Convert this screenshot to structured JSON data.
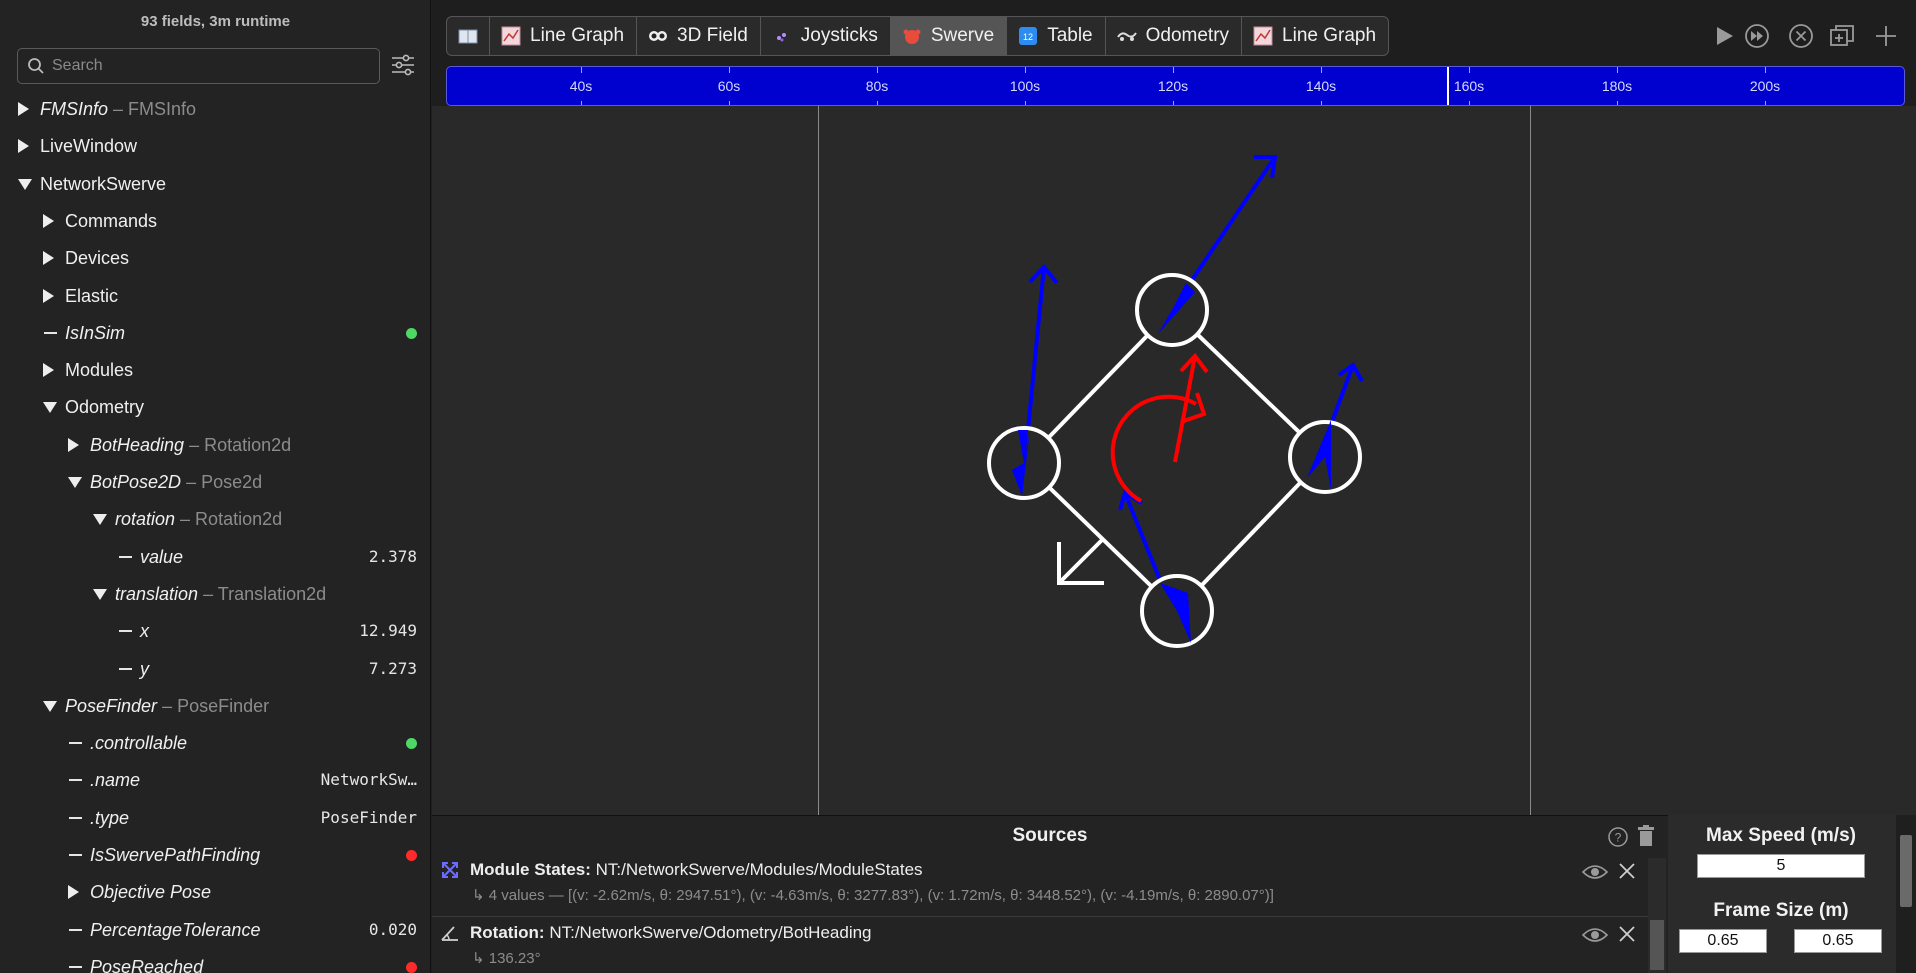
{
  "sidebar": {
    "runtime": "93 fields, 3m runtime",
    "search_placeholder": "Search",
    "tree": [
      {
        "label": "FMSInfo",
        "type": " – FMSInfo",
        "italic": true,
        "kind": "closed",
        "indent": 0
      },
      {
        "label": "LiveWindow",
        "type": "",
        "italic": false,
        "kind": "closed",
        "indent": 0
      },
      {
        "label": "NetworkSwerve",
        "type": "",
        "italic": false,
        "kind": "open",
        "indent": 0
      },
      {
        "label": "Commands",
        "type": "",
        "italic": false,
        "kind": "closed",
        "indent": 1
      },
      {
        "label": "Devices",
        "type": "",
        "italic": false,
        "kind": "closed",
        "indent": 1
      },
      {
        "label": "Elastic",
        "type": "",
        "italic": false,
        "kind": "closed",
        "indent": 1
      },
      {
        "label": "IsInSim",
        "type": "",
        "italic": true,
        "kind": "leaf",
        "indent": 1,
        "dot": "#4cd964"
      },
      {
        "label": "Modules",
        "type": "",
        "italic": false,
        "kind": "closed",
        "indent": 1
      },
      {
        "label": "Odometry",
        "type": "",
        "italic": false,
        "kind": "open",
        "indent": 1
      },
      {
        "label": "BotHeading",
        "type": " – Rotation2d",
        "italic": true,
        "kind": "closed",
        "indent": 2
      },
      {
        "label": "BotPose2D",
        "type": " – Pose2d",
        "italic": true,
        "kind": "open",
        "indent": 2
      },
      {
        "label": "rotation",
        "type": " – Rotation2d",
        "italic": true,
        "kind": "open",
        "indent": 3
      },
      {
        "label": "value",
        "type": "",
        "italic": true,
        "kind": "leaf",
        "indent": 4,
        "value": "2.378"
      },
      {
        "label": "translation",
        "type": " – Translation2d",
        "italic": true,
        "kind": "open",
        "indent": 3
      },
      {
        "label": "x",
        "type": "",
        "italic": true,
        "kind": "leaf",
        "indent": 4,
        "value": "12.949"
      },
      {
        "label": "y",
        "type": "",
        "italic": true,
        "kind": "leaf",
        "indent": 4,
        "value": "7.273"
      },
      {
        "label": "PoseFinder",
        "type": " – PoseFinder",
        "italic": true,
        "kind": "open",
        "indent": 1
      },
      {
        "label": ".controllable",
        "type": "",
        "italic": true,
        "kind": "leaf",
        "indent": 2,
        "dot": "#4cd964"
      },
      {
        "label": ".name",
        "type": "",
        "italic": true,
        "kind": "leaf",
        "indent": 2,
        "value": "NetworkSw…"
      },
      {
        "label": ".type",
        "type": "",
        "italic": true,
        "kind": "leaf",
        "indent": 2,
        "value": "PoseFinder"
      },
      {
        "label": "IsSwervePathFinding",
        "type": "",
        "italic": true,
        "kind": "leaf",
        "indent": 2,
        "dot": "#ff2a2a"
      },
      {
        "label": "Objective Pose",
        "type": "",
        "italic": true,
        "kind": "closed",
        "indent": 2
      },
      {
        "label": "PercentageTolerance",
        "type": "",
        "italic": true,
        "kind": "leaf",
        "indent": 2,
        "value": "0.020"
      },
      {
        "label": "PoseReached",
        "type": "",
        "italic": true,
        "kind": "leaf",
        "indent": 2,
        "dot": "#ff2a2a"
      }
    ]
  },
  "tabs": [
    {
      "label": "",
      "icon": "book-icon",
      "active": false
    },
    {
      "label": "Line Graph",
      "icon": "line-graph-icon",
      "active": false
    },
    {
      "label": "3D Field",
      "icon": "3d-field-icon",
      "active": false
    },
    {
      "label": "Joysticks",
      "icon": "joystick-icon",
      "active": false
    },
    {
      "label": "Swerve",
      "icon": "swerve-icon",
      "active": true
    },
    {
      "label": "Table",
      "icon": "table-icon",
      "active": false
    },
    {
      "label": "Odometry",
      "icon": "odometry-icon",
      "active": false
    },
    {
      "label": "Line Graph",
      "icon": "line-graph-icon",
      "active": false
    }
  ],
  "timeline": {
    "ticks": [
      "40s",
      "60s",
      "80s",
      "100s",
      "120s",
      "140s",
      "160s",
      "180s",
      "200s"
    ]
  },
  "sources": {
    "title": "Sources",
    "rows": [
      {
        "key": "Module States:",
        "path": "NT:/NetworkSwerve/Modules/ModuleStates",
        "detail": "↳ 4 values — [(v: -2.62m/s, θ: 2947.51°), (v: -4.63m/s, θ: 3277.83°), (v: 1.72m/s, θ: 3448.52°), (v: -4.19m/s, θ: 2890.07°)]",
        "icon": "module-states-icon"
      },
      {
        "key": "Rotation:",
        "path": "NT:/NetworkSwerve/Odometry/BotHeading",
        "detail": "↳ 136.23°",
        "icon": "rotation-icon"
      }
    ]
  },
  "options": {
    "max_speed_label": "Max Speed (m/s)",
    "max_speed_value": "5",
    "frame_size_label": "Frame Size (m)",
    "frame_width": "0.65",
    "frame_length": "0.65"
  },
  "colors": {
    "timeline": "#0000cf",
    "module_vector": "#0000ff",
    "chassis_vector": "#ff0000"
  }
}
